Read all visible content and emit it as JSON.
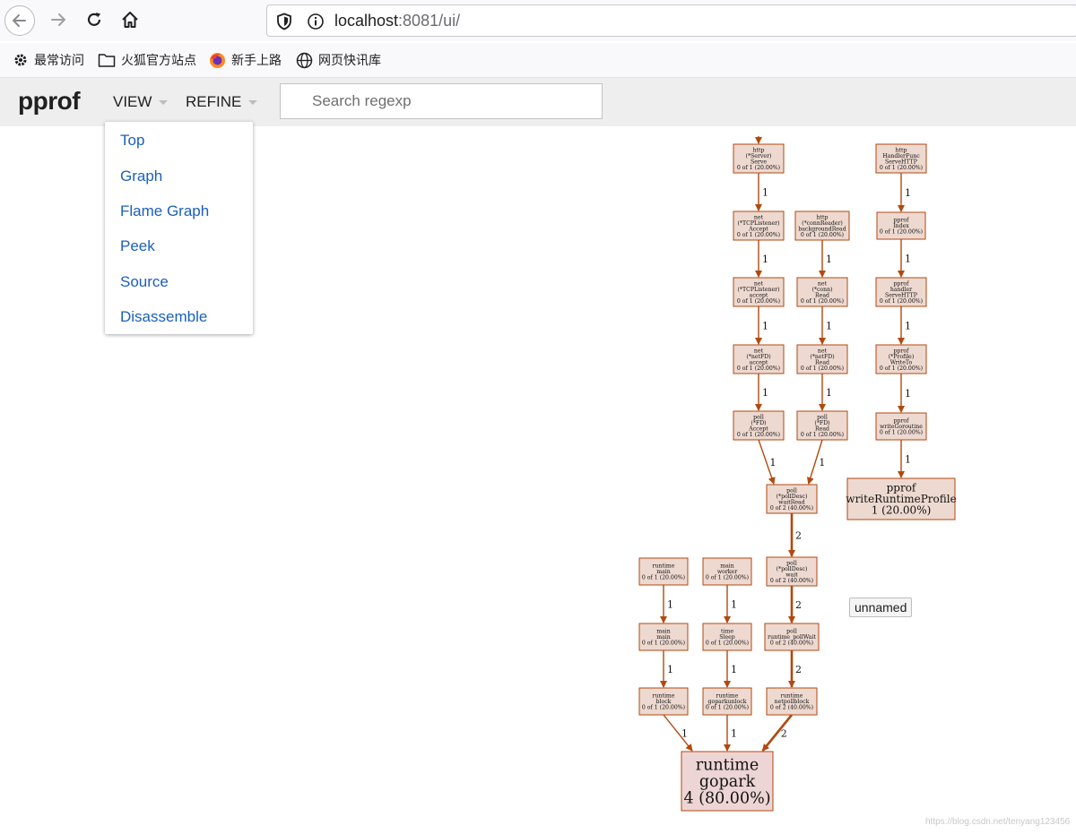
{
  "browser": {
    "url_host": "localhost",
    "url_rest": ":8081/ui/",
    "bookmarks": [
      "最常访问",
      "火狐官方站点",
      "新手上路",
      "网页快讯库"
    ]
  },
  "header": {
    "logo": "pprof",
    "menus": [
      "VIEW",
      "REFINE"
    ],
    "search_placeholder": "Search regexp"
  },
  "view_menu": {
    "items": [
      "Top",
      "Graph",
      "Flame Graph",
      "Peek",
      "Source",
      "Disassemble"
    ]
  },
  "graph": {
    "nodes": [
      {
        "id": "http_serve",
        "lines": [
          "http",
          "(*Server)",
          "Serve",
          "0 of 1 (20.00%)"
        ]
      },
      {
        "id": "tcp_Accept",
        "lines": [
          "net",
          "(*TCPListener)",
          "Accept",
          "0 of 1 (20.00%)"
        ]
      },
      {
        "id": "tcp_accept",
        "lines": [
          "net",
          "(*TCPListener)",
          "accept",
          "0 of 1 (20.00%)"
        ]
      },
      {
        "id": "netfd_accept",
        "lines": [
          "net",
          "(*netFD)",
          "accept",
          "0 of 1 (20.00%)"
        ]
      },
      {
        "id": "fd_Accept",
        "lines": [
          "poll",
          "(*FD)",
          "Accept",
          "0 of 1 (20.00%)"
        ]
      },
      {
        "id": "conn_bg",
        "lines": [
          "http",
          "(*connReader)",
          "backgroundRead",
          "0 of 1 (20.00%)"
        ]
      },
      {
        "id": "conn_read",
        "lines": [
          "net",
          "(*conn)",
          "Read",
          "0 of 1 (20.00%)"
        ]
      },
      {
        "id": "netfd_read",
        "lines": [
          "net",
          "(*netFD)",
          "Read",
          "0 of 1 (20.00%)"
        ]
      },
      {
        "id": "fd_read",
        "lines": [
          "poll",
          "(*FD)",
          "Read",
          "0 of 1 (20.00%)"
        ]
      },
      {
        "id": "waitread",
        "lines": [
          "poll",
          "(*pollDesc)",
          "waitRead",
          "0 of 2 (40.00%)"
        ]
      },
      {
        "id": "wait",
        "lines": [
          "poll",
          "(*pollDesc)",
          "wait",
          "0 of 2 (40.00%)"
        ]
      },
      {
        "id": "pollwait",
        "lines": [
          "poll",
          "runtime_pollWait",
          "0 of 2 (40.00%)"
        ]
      },
      {
        "id": "netpollblock",
        "lines": [
          "runtime",
          "netpollblock",
          "0 of 2 (40.00%)"
        ]
      },
      {
        "id": "rt_main",
        "lines": [
          "runtime",
          "main",
          "0 of 1 (20.00%)"
        ]
      },
      {
        "id": "main_main",
        "lines": [
          "main",
          "main",
          "0 of 1 (20.00%)"
        ]
      },
      {
        "id": "rt_block",
        "lines": [
          "runtime",
          "block",
          "0 of 1 (20.00%)"
        ]
      },
      {
        "id": "main_worker",
        "lines": [
          "main",
          "worker",
          "0 of 1 (20.00%)"
        ]
      },
      {
        "id": "time_sleep",
        "lines": [
          "time",
          "Sleep",
          "0 of 1 (20.00%)"
        ]
      },
      {
        "id": "goparkunlock",
        "lines": [
          "runtime",
          "goparkunlock",
          "0 of 1 (20.00%)"
        ]
      },
      {
        "id": "gopark",
        "lines": [
          "runtime",
          "gopark",
          "4 (80.00%)"
        ]
      },
      {
        "id": "handlerfunc",
        "lines": [
          "http",
          "HandlerFunc",
          "ServeHTTP",
          "0 of 1 (20.00%)"
        ]
      },
      {
        "id": "pprof_index",
        "lines": [
          "pprof",
          "Index",
          "0 of 1 (20.00%)"
        ]
      },
      {
        "id": "pprof_handler",
        "lines": [
          "pprof",
          "handler",
          "ServeHTTP",
          "0 of 1 (20.00%)"
        ]
      },
      {
        "id": "profile_writeto",
        "lines": [
          "pprof",
          "(*Profile)",
          "WriteTo",
          "0 of 1 (20.00%)"
        ]
      },
      {
        "id": "writegoroutine",
        "lines": [
          "pprof",
          "writeGoroutine",
          "0 of 1 (20.00%)"
        ]
      },
      {
        "id": "writeruntimeprofile",
        "lines": [
          "pprof",
          "writeRuntimeProfile",
          "1 (20.00%)"
        ]
      }
    ],
    "edges": [
      {
        "from": "http_serve",
        "to": "tcp_Accept",
        "label": "1"
      },
      {
        "from": "tcp_Accept",
        "to": "tcp_accept",
        "label": "1"
      },
      {
        "from": "tcp_accept",
        "to": "netfd_accept",
        "label": "1"
      },
      {
        "from": "netfd_accept",
        "to": "fd_Accept",
        "label": "1"
      },
      {
        "from": "fd_Accept",
        "to": "waitread",
        "label": "1"
      },
      {
        "from": "conn_bg",
        "to": "conn_read",
        "label": "1"
      },
      {
        "from": "conn_read",
        "to": "netfd_read",
        "label": "1"
      },
      {
        "from": "netfd_read",
        "to": "fd_read",
        "label": "1"
      },
      {
        "from": "fd_read",
        "to": "waitread",
        "label": "1"
      },
      {
        "from": "waitread",
        "to": "wait",
        "label": "2"
      },
      {
        "from": "wait",
        "to": "pollwait",
        "label": "2"
      },
      {
        "from": "pollwait",
        "to": "netpollblock",
        "label": "2"
      },
      {
        "from": "netpollblock",
        "to": "gopark",
        "label": "2"
      },
      {
        "from": "rt_main",
        "to": "main_main",
        "label": "1"
      },
      {
        "from": "main_main",
        "to": "rt_block",
        "label": "1"
      },
      {
        "from": "rt_block",
        "to": "gopark",
        "label": "1"
      },
      {
        "from": "main_worker",
        "to": "time_sleep",
        "label": "1"
      },
      {
        "from": "time_sleep",
        "to": "goparkunlock",
        "label": "1"
      },
      {
        "from": "goparkunlock",
        "to": "gopark",
        "label": "1"
      },
      {
        "from": "handlerfunc",
        "to": "pprof_index",
        "label": "1"
      },
      {
        "from": "pprof_index",
        "to": "pprof_handler",
        "label": "1"
      },
      {
        "from": "pprof_handler",
        "to": "profile_writeto",
        "label": "1"
      },
      {
        "from": "profile_writeto",
        "to": "writegoroutine",
        "label": "1"
      },
      {
        "from": "writegoroutine",
        "to": "writeruntimeprofile",
        "label": "1"
      }
    ]
  },
  "tooltip": "unnamed",
  "watermark": "https://blog.csdn.net/tenyang123456"
}
